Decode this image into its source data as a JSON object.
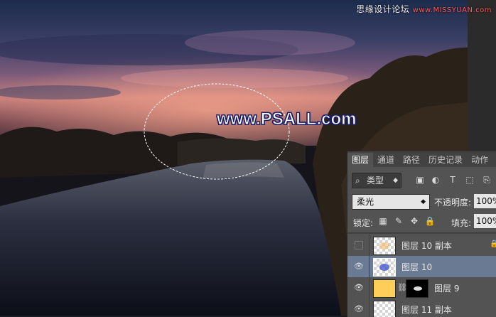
{
  "watermark": {
    "site": "思缘设计论坛",
    "url": "www.MISSYUAN.com",
    "center_text": "www.PSALL.com"
  },
  "layers_panel": {
    "tabs": [
      {
        "label": "图层",
        "active": true
      },
      {
        "label": "通道"
      },
      {
        "label": "路径"
      },
      {
        "label": "历史记录"
      },
      {
        "label": "动作"
      }
    ],
    "filter": {
      "kind_label": "类型",
      "search_icon": "search-icon",
      "dropdown_icon": "chevron-down-icon"
    },
    "filter_icons": [
      "image-filter-icon",
      "adjustment-filter-icon",
      "type-filter-icon",
      "shape-filter-icon",
      "smart-object-filter-icon"
    ],
    "filter_glyphs": [
      "▣",
      "◐",
      "T",
      "⬚",
      "⎘"
    ],
    "blend_mode": "柔光",
    "opacity_label": "不透明度:",
    "opacity_value": "100%",
    "lock_label": "锁定:",
    "lock_icons": [
      "lock-transparent-icon",
      "lock-image-icon",
      "lock-position-icon",
      "lock-all-icon"
    ],
    "lock_glyphs": [
      "▦",
      "✎",
      "✥",
      "🔒"
    ],
    "fill_label": "填充:",
    "fill_value": "100%",
    "layers": [
      {
        "name": "图层 10 副本",
        "visible": false,
        "locked": true
      },
      {
        "name": "图层 10",
        "visible": true,
        "selected": true
      },
      {
        "name": "图层 9",
        "visible": true,
        "has_mask": true,
        "thumb_color": "#ffcd5a"
      },
      {
        "name": "图层 11 副本",
        "visible": true
      }
    ]
  },
  "colors": {
    "panel_bg": "#535353",
    "selected_layer": "#6a7a93",
    "watermark_red": "#ff5a5a"
  }
}
